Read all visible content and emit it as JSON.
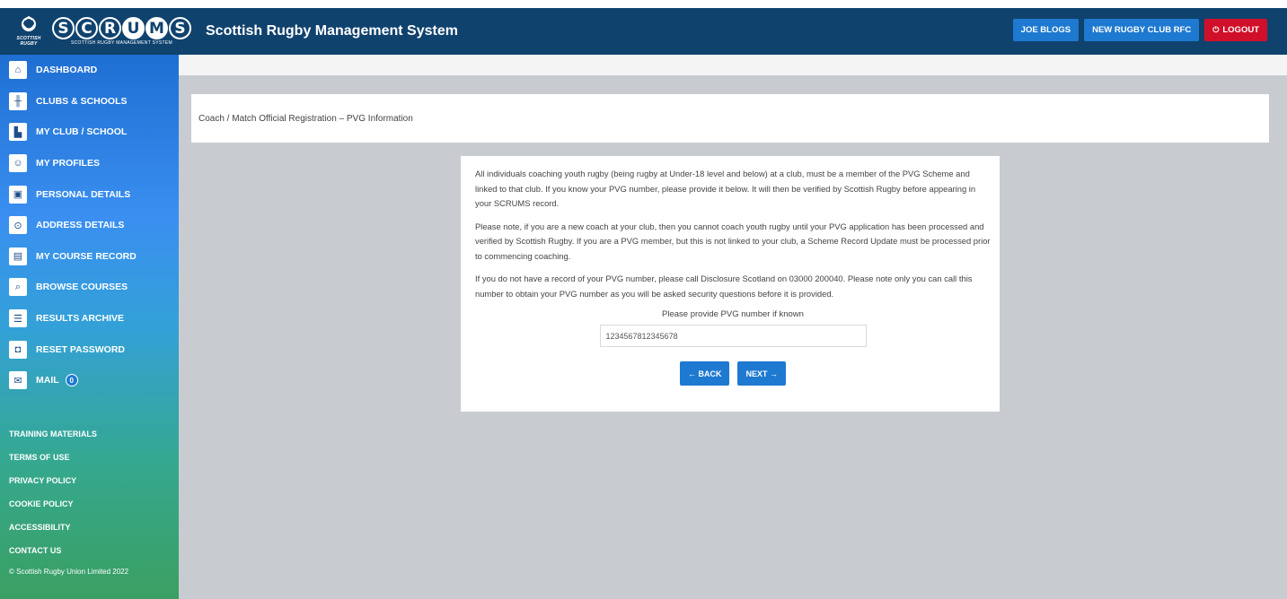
{
  "header": {
    "crest_text": "SCOTTISH RUGBY",
    "logo_letters": [
      "S",
      "C",
      "R",
      "U",
      "M",
      "S"
    ],
    "logo_sub": "SCOTTISH RUGBY MANAGEMENT SYSTEM",
    "title": "Scottish Rugby Management System",
    "user_button": "JOE BLOGS",
    "club_button": "NEW RUGBY CLUB RFC",
    "logout_button": "LOGOUT",
    "colors": {
      "header_bg": "#10426e",
      "button_blue": "#1e79d0",
      "logout_red": "#d0102a"
    }
  },
  "sidebar": {
    "items": [
      {
        "label": "DASHBOARD",
        "icon": "home-icon"
      },
      {
        "label": "CLUBS & SCHOOLS",
        "icon": "goalposts-icon"
      },
      {
        "label": "MY CLUB / SCHOOL",
        "icon": "clubhouse-icon"
      },
      {
        "label": "MY PROFILES",
        "icon": "profile-icon"
      },
      {
        "label": "PERSONAL DETAILS",
        "icon": "id-card-icon"
      },
      {
        "label": "ADDRESS DETAILS",
        "icon": "location-pin-icon"
      },
      {
        "label": "MY COURSE RECORD",
        "icon": "document-icon"
      },
      {
        "label": "BROWSE COURSES",
        "icon": "search-document-icon"
      },
      {
        "label": "RESULTS ARCHIVE",
        "icon": "archive-icon"
      },
      {
        "label": "RESET PASSWORD",
        "icon": "lock-icon"
      },
      {
        "label": "MAIL",
        "icon": "mail-icon",
        "badge": "0"
      }
    ],
    "footer_links": [
      "TRAINING MATERIALS",
      "TERMS OF USE",
      "PRIVACY POLICY",
      "COOKIE POLICY",
      "ACCESSIBILITY",
      "CONTACT US"
    ],
    "copyright": "© Scottish Rugby Union Limited 2022"
  },
  "main": {
    "breadcrumb": "Coach / Match Official Registration – PVG Information",
    "paragraphs": [
      "All individuals coaching youth rugby (being rugby at Under-18 level and below) at a club, must be a member of the PVG Scheme and linked to that club. If you know your PVG number, please provide it below. It will then be verified by Scottish Rugby before appearing in your SCRUMS record.",
      "Please note, if you are a new coach at your club, then you cannot coach youth rugby until your PVG application has been processed and verified by Scottish Rugby. If you are a PVG member, but this is not linked to your club, a Scheme Record Update must be processed prior to commencing coaching.",
      "If you do not have a record of your PVG number, please call Disclosure Scotland on 03000 200040. Please note only you can call this number to obtain your PVG number as you will be asked security questions before it is provided."
    ],
    "pvg_label": "Please provide PVG number if known",
    "pvg_value": "1234567812345678",
    "back_button": "BACK",
    "next_button": "NEXT"
  }
}
